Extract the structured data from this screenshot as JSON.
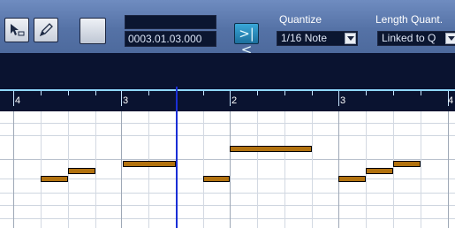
{
  "toolbar": {
    "tools": [
      {
        "name": "object-selection-tool"
      },
      {
        "name": "draw-tool"
      }
    ],
    "position_readout": "0003.01.03.000",
    "quantize": {
      "label": "Quantize",
      "value": "1/16 Note"
    },
    "length_quantize": {
      "label": "Length Quant.",
      "value": "Linked to Q"
    }
  },
  "ruler": {
    "labels": [
      "4",
      "3",
      "2",
      "3",
      "4"
    ]
  },
  "colors": {
    "toolbar": "#5876aa",
    "ruler_line": "#8fd9ff",
    "note_fill": "#b2720f",
    "playhead": "#1a2fd6"
  }
}
